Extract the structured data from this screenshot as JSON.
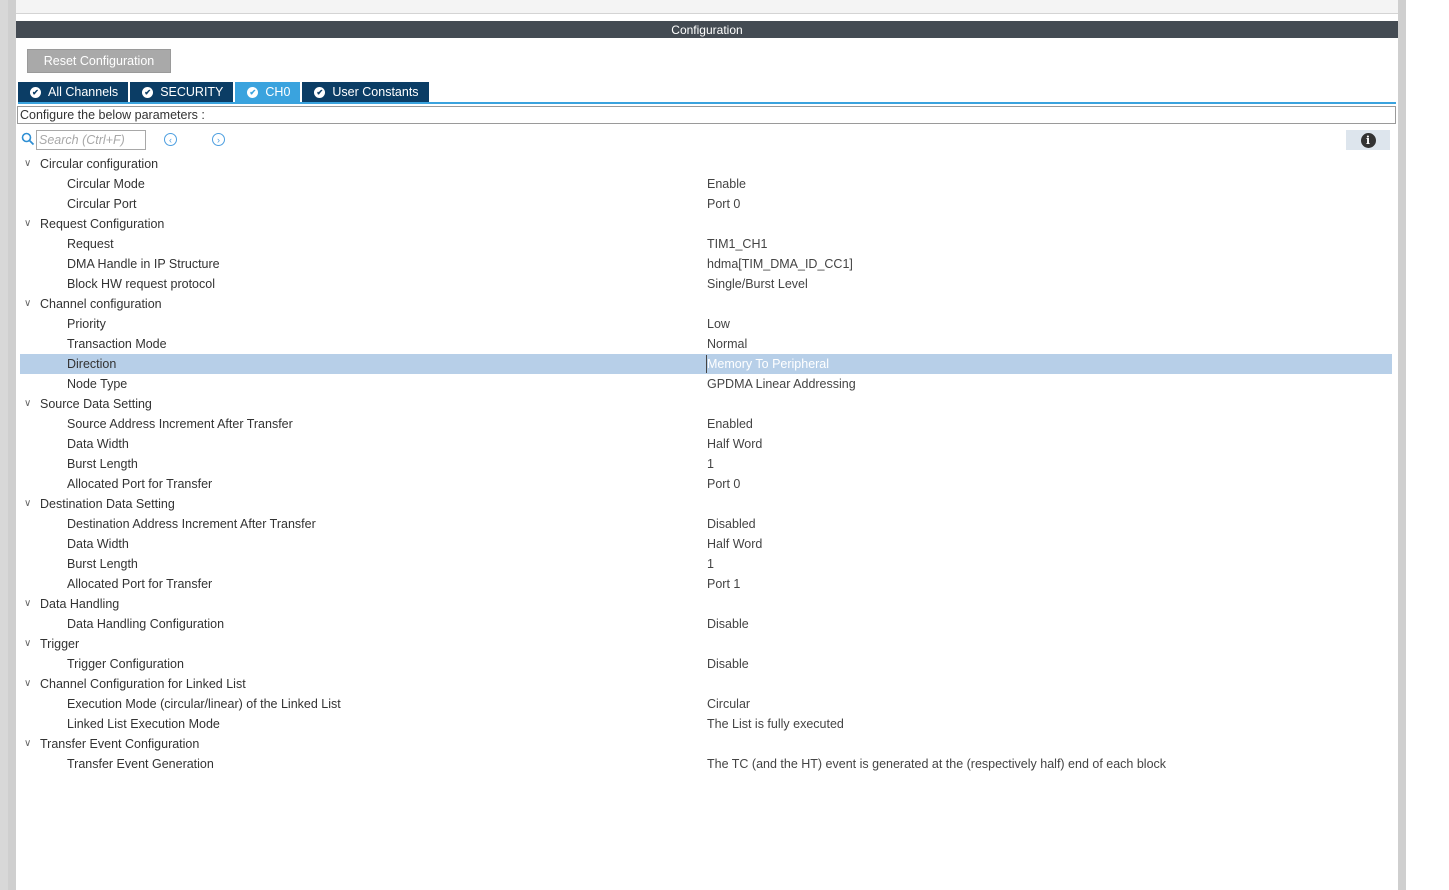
{
  "header": {
    "title": "Configuration"
  },
  "toolbar": {
    "reset_label": "Reset Configuration"
  },
  "tabs": [
    {
      "label": "All Channels",
      "active": false
    },
    {
      "label": "SECURITY",
      "active": false
    },
    {
      "label": "CH0",
      "active": true
    },
    {
      "label": "User Constants",
      "active": false
    }
  ],
  "hint": "Configure the below parameters :",
  "search": {
    "placeholder": "Search (Ctrl+F)"
  },
  "colors": {
    "header_bg": "#444b53",
    "tab_bg": "#0b3d65",
    "tab_active": "#3aa3de",
    "selection": "#b7cfe8"
  },
  "groups": [
    {
      "label": "Circular configuration",
      "params": [
        {
          "name": "Circular Mode",
          "value": "Enable"
        },
        {
          "name": "Circular Port",
          "value": "Port 0"
        }
      ]
    },
    {
      "label": "Request Configuration",
      "params": [
        {
          "name": "Request",
          "value": "TIM1_CH1"
        },
        {
          "name": "DMA Handle in IP Structure",
          "value": "hdma[TIM_DMA_ID_CC1]"
        },
        {
          "name": "Block HW request protocol",
          "value": "Single/Burst Level"
        }
      ]
    },
    {
      "label": "Channel configuration",
      "params": [
        {
          "name": "Priority",
          "value": "Low"
        },
        {
          "name": "Transaction Mode",
          "value": "Normal"
        },
        {
          "name": "Direction",
          "value": "Memory To Peripheral",
          "selected": true
        },
        {
          "name": "Node Type",
          "value": "GPDMA Linear Addressing"
        }
      ]
    },
    {
      "label": "Source Data Setting",
      "params": [
        {
          "name": "Source Address Increment After Transfer",
          "value": "Enabled"
        },
        {
          "name": "Data Width",
          "value": "Half Word"
        },
        {
          "name": "Burst Length",
          "value": "1"
        },
        {
          "name": "Allocated Port for Transfer",
          "value": "Port 0"
        }
      ]
    },
    {
      "label": "Destination Data Setting",
      "params": [
        {
          "name": "Destination Address Increment After Transfer",
          "value": "Disabled"
        },
        {
          "name": "Data Width",
          "value": "Half Word"
        },
        {
          "name": "Burst Length",
          "value": "1"
        },
        {
          "name": "Allocated Port for Transfer",
          "value": "Port 1"
        }
      ]
    },
    {
      "label": "Data Handling",
      "params": [
        {
          "name": "Data Handling Configuration",
          "value": "Disable"
        }
      ]
    },
    {
      "label": "Trigger",
      "params": [
        {
          "name": "Trigger Configuration",
          "value": "Disable"
        }
      ]
    },
    {
      "label": "Channel Configuration for Linked List",
      "params": [
        {
          "name": "Execution Mode (circular/linear) of the Linked List",
          "value": "Circular"
        },
        {
          "name": "Linked List Execution Mode",
          "value": "The List is fully executed"
        }
      ]
    },
    {
      "label": "Transfer Event Configuration",
      "params": [
        {
          "name": "Transfer Event Generation",
          "value": "The TC (and the HT) event is generated at the (respectively half) end of each block"
        }
      ]
    }
  ]
}
